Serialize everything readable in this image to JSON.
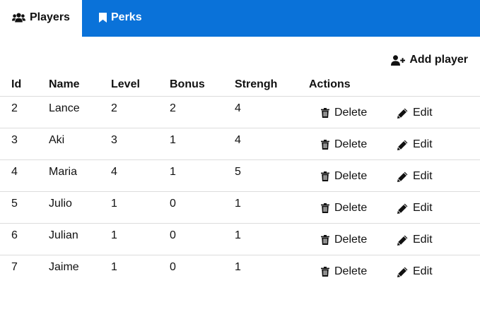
{
  "tabs": [
    {
      "label": "Players",
      "icon": "users-icon",
      "active": true
    },
    {
      "label": "Perks",
      "icon": "bookmark-icon",
      "active": false
    }
  ],
  "colors": {
    "tabbar": "#0a72d9",
    "active_tab": "#ffffff"
  },
  "toolbar": {
    "add_player_label": "Add player",
    "add_player_icon": "user-plus-icon"
  },
  "table": {
    "headers": [
      "Id",
      "Name",
      "Level",
      "Bonus",
      "Strengh",
      "Actions"
    ],
    "rows": [
      {
        "id": "2",
        "name": "Lance",
        "level": "2",
        "bonus": "2",
        "strength": "4"
      },
      {
        "id": "3",
        "name": "Aki",
        "level": "3",
        "bonus": "1",
        "strength": "4"
      },
      {
        "id": "4",
        "name": "Maria",
        "level": "4",
        "bonus": "1",
        "strength": "5"
      },
      {
        "id": "5",
        "name": "Julio",
        "level": "1",
        "bonus": "0",
        "strength": "1"
      },
      {
        "id": "6",
        "name": "Julian",
        "level": "1",
        "bonus": "0",
        "strength": "1"
      },
      {
        "id": "7",
        "name": "Jaime",
        "level": "1",
        "bonus": "0",
        "strength": "1"
      }
    ],
    "delete_label": "Delete",
    "edit_label": "Edit"
  }
}
